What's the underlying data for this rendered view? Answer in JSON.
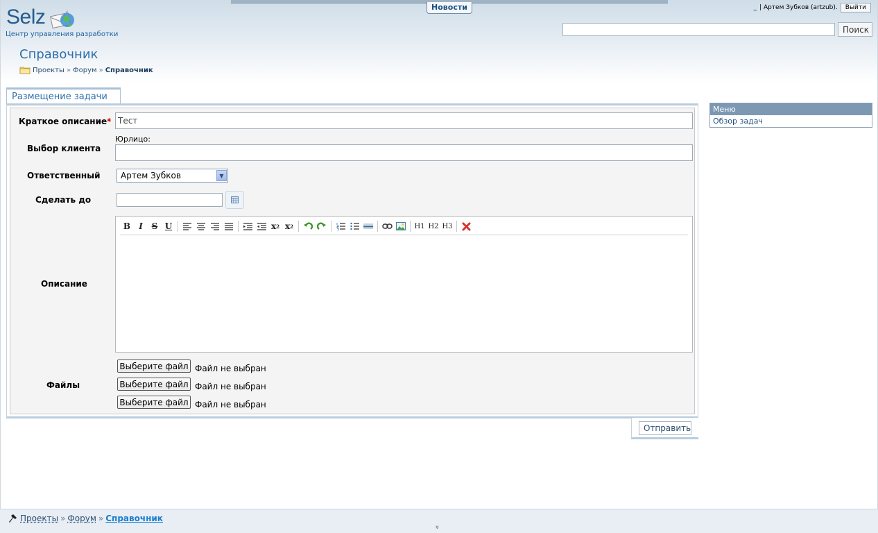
{
  "header": {
    "news_tab": "Новости",
    "logo_text": "Selz",
    "logo_subtitle": "Центр управления разработки",
    "user_icon": "_",
    "user_label": "| Артем Зубков (artzub).",
    "logout_label": "Выйти",
    "search": {
      "value": "",
      "button_label": "Поиск"
    }
  },
  "page": {
    "title": "Справочник",
    "breadcrumb": [
      "Проекты",
      "»",
      "Форум",
      "»",
      "Справочник"
    ]
  },
  "form": {
    "tab_label": "Размещение задачи",
    "short_desc": {
      "label": "Краткое описание",
      "required_mark": "*",
      "value": "Тест"
    },
    "client": {
      "label": "Выбор клиента",
      "sublabel": "Юрлицо:",
      "value": ""
    },
    "responsible": {
      "label": "Ответственный",
      "selected": "Артем Зубков"
    },
    "deadline": {
      "label": "Сделать до",
      "value": ""
    },
    "description": {
      "label": "Описание",
      "value": ""
    },
    "files": {
      "label": "Файлы",
      "items": [
        {
          "button": "Выберите файл",
          "status": "Файл не выбран"
        },
        {
          "button": "Выберите файл",
          "status": "Файл не выбран"
        },
        {
          "button": "Выберите файл",
          "status": "Файл не выбран"
        }
      ]
    },
    "submit_label": "Отправить"
  },
  "toolbar": {
    "bold": "B",
    "italic": "I",
    "strike": "S",
    "underline": "U",
    "subscript": "x",
    "superscript": "x",
    "h1": "H1",
    "h2": "H2",
    "h3": "H3"
  },
  "menu": {
    "header": "Меню",
    "items": [
      "Обзор задач"
    ]
  },
  "footer": {
    "breadcrumb": [
      "Проекты",
      "»",
      "Форум",
      "»",
      "Справочник"
    ],
    "expand_icon": "»"
  },
  "colors": {
    "accent": "#2f6fa9",
    "required": "#d30000",
    "menu_header": "#7d98b3"
  }
}
